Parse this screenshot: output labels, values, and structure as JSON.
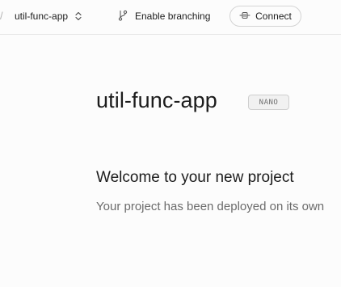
{
  "header": {
    "separator": "/",
    "project_name": "util-func-app",
    "branching_label": "Enable branching",
    "connect_label": "Connect"
  },
  "main": {
    "project_title": "util-func-app",
    "plan_badge": "NANO",
    "welcome_heading": "Welcome to your new project",
    "deploy_text": "Your project has been deployed on its own"
  },
  "icons": {
    "project_switch": "chevron-up-down-icon",
    "branching": "git-branch-icon",
    "connect": "plug-icon"
  }
}
